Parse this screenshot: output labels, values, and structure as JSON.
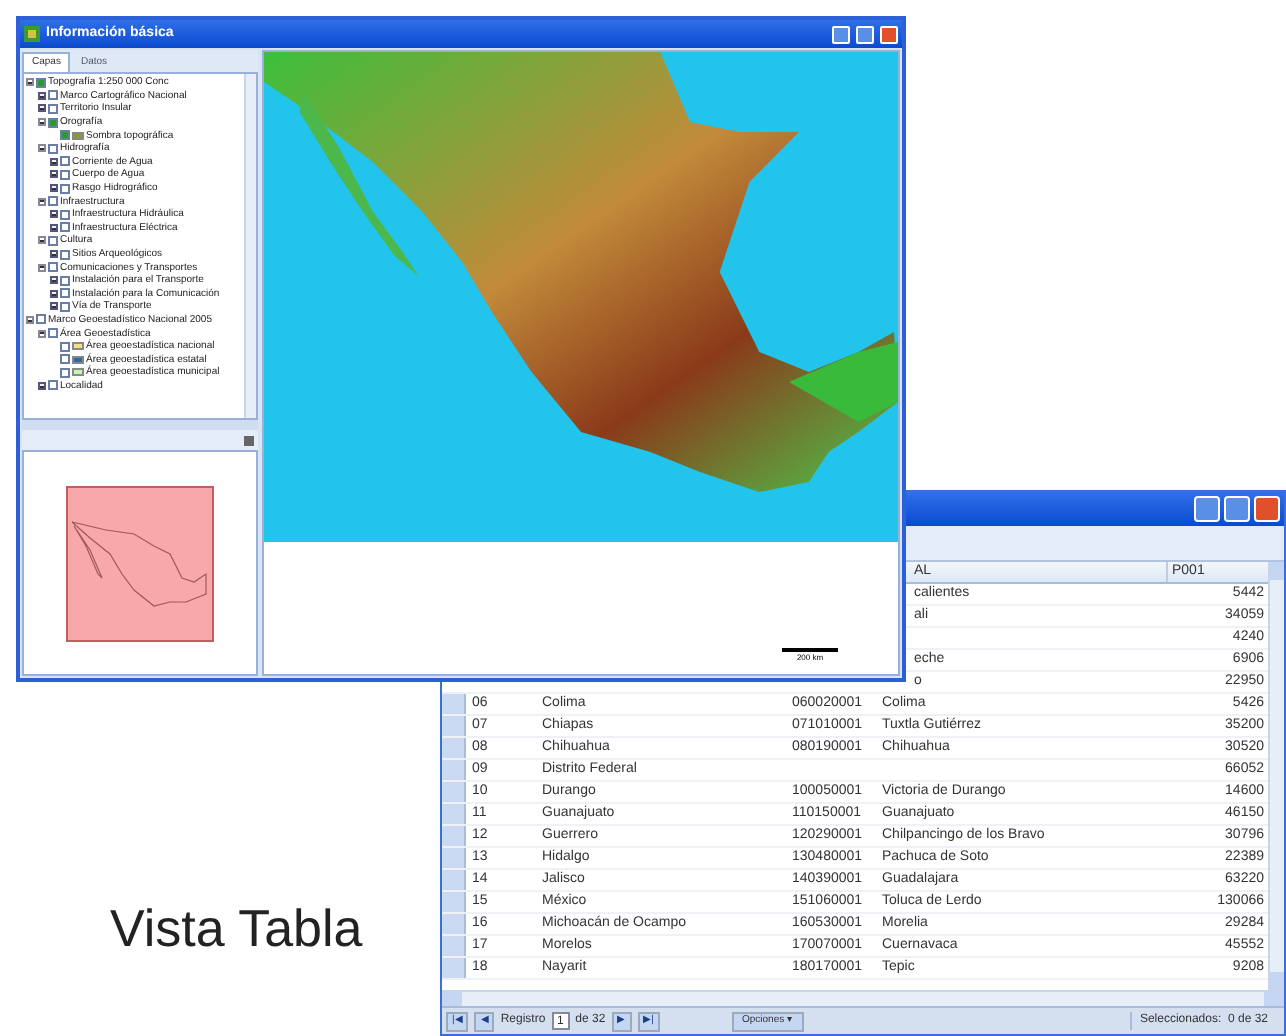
{
  "map_window": {
    "title": "Información básica",
    "tabs": [
      {
        "label": "Capas",
        "selected": true
      },
      {
        "label": "Datos",
        "selected": false
      }
    ],
    "layers": [
      {
        "label": "Topografía 1:250 000 Conc",
        "checked": true,
        "expanded": true,
        "children": [
          {
            "label": "Marco Cartográfico Nacional",
            "checked": false,
            "expanded": false
          },
          {
            "label": "Territorio Insular",
            "checked": false,
            "expanded": false
          },
          {
            "label": "Orografía",
            "checked": true,
            "expanded": true,
            "children": [
              {
                "label": "Sombra topográfica",
                "checked": true,
                "color": "#8a9a3a"
              }
            ]
          },
          {
            "label": "Hidrografía",
            "checked": false,
            "expanded": true,
            "children": [
              {
                "label": "Corriente de Agua",
                "checked": false,
                "expanded": false
              },
              {
                "label": "Cuerpo de Agua",
                "checked": false,
                "expanded": false
              },
              {
                "label": "Rasgo Hidrográfico",
                "checked": false,
                "expanded": false
              }
            ]
          },
          {
            "label": "Infraestructura",
            "checked": false,
            "expanded": true,
            "children": [
              {
                "label": "Infraestructura Hidráulica",
                "checked": false,
                "expanded": false
              },
              {
                "label": "Infraestructura Eléctrica",
                "checked": false,
                "expanded": false
              }
            ]
          },
          {
            "label": "Cultura",
            "checked": false,
            "expanded": true,
            "children": [
              {
                "label": "Sitios Arqueológicos",
                "checked": false,
                "expanded": false
              }
            ]
          },
          {
            "label": "Comunicaciones y Transportes",
            "checked": false,
            "expanded": true,
            "children": [
              {
                "label": "Instalación para el Transporte",
                "checked": false,
                "expanded": false
              },
              {
                "label": "Instalación para la Comunicación",
                "checked": false,
                "expanded": false
              },
              {
                "label": "Vía de Transporte",
                "checked": false,
                "expanded": false
              }
            ]
          }
        ]
      },
      {
        "label": "Marco Geoestadístico Nacional 2005",
        "checked": false,
        "expanded": true,
        "children": [
          {
            "label": "Área Geoestadística",
            "checked": false,
            "expanded": true,
            "children": [
              {
                "label": "Área geoestadística nacional",
                "checked": false,
                "color": "#f5e08a"
              },
              {
                "label": "Área geoestadística estatal",
                "checked": false,
                "color": "#2a6aa8"
              },
              {
                "label": "Área geoestadística municipal",
                "checked": false,
                "color": "#c8f5b0"
              }
            ]
          },
          {
            "label": "Localidad",
            "checked": false,
            "expanded": false
          }
        ]
      }
    ],
    "scale": "200 km"
  },
  "table_window": {
    "columns": [
      "AL",
      "P001"
    ],
    "rows": [
      {
        "column_4": "calientes",
        "p001": "5442"
      },
      {
        "column_4": "ali",
        "p001": "34059"
      },
      {
        "column_4": "",
        "p001": "4240"
      },
      {
        "column_4": "eche",
        "p001": "6906"
      },
      {
        "column_4": "o",
        "p001": "22950"
      },
      {
        "id": "06",
        "name": "Colima",
        "code": "060020001",
        "column_4": "Colima",
        "p001": "5426"
      },
      {
        "id": "07",
        "name": "Chiapas",
        "code": "071010001",
        "column_4": "Tuxtla Gutiérrez",
        "p001": "35200"
      },
      {
        "id": "08",
        "name": "Chihuahua",
        "code": "080190001",
        "column_4": "Chihuahua",
        "p001": "30520"
      },
      {
        "id": "09",
        "name": "Distrito Federal",
        "code": "",
        "column_4": "",
        "p001": "66052"
      },
      {
        "id": "10",
        "name": "Durango",
        "code": "100050001",
        "column_4": "Victoria de Durango",
        "p001": "14600"
      },
      {
        "id": "11",
        "name": "Guanajuato",
        "code": "110150001",
        "column_4": "Guanajuato",
        "p001": "46150"
      },
      {
        "id": "12",
        "name": "Guerrero",
        "code": "120290001",
        "column_4": "Chilpancingo de los Bravo",
        "p001": "30796"
      },
      {
        "id": "13",
        "name": "Hidalgo",
        "code": "130480001",
        "column_4": "Pachuca de Soto",
        "p001": "22389"
      },
      {
        "id": "14",
        "name": "Jalisco",
        "code": "140390001",
        "column_4": "Guadalajara",
        "p001": "63220"
      },
      {
        "id": "15",
        "name": "México",
        "code": "151060001",
        "column_4": "Toluca de Lerdo",
        "p001": "130066"
      },
      {
        "id": "16",
        "name": "Michoacán de Ocampo",
        "code": "160530001",
        "column_4": "Morelia",
        "p001": "29284"
      },
      {
        "id": "17",
        "name": "Morelos",
        "code": "170070001",
        "column_4": "Cuernavaca",
        "p001": "45552"
      },
      {
        "id": "18",
        "name": "Nayarit",
        "code": "180170001",
        "column_4": "Tepic",
        "p001": "9208"
      }
    ],
    "pager": {
      "first": "|◀",
      "prev": "◀",
      "record_label": "Registro",
      "record": "1",
      "of": "de 32",
      "next": "▶",
      "last": "▶|"
    },
    "options": "Opciones ▾",
    "selected_count": "Seleccionados:  0 de 32"
  },
  "caption": "Vista Tabla"
}
